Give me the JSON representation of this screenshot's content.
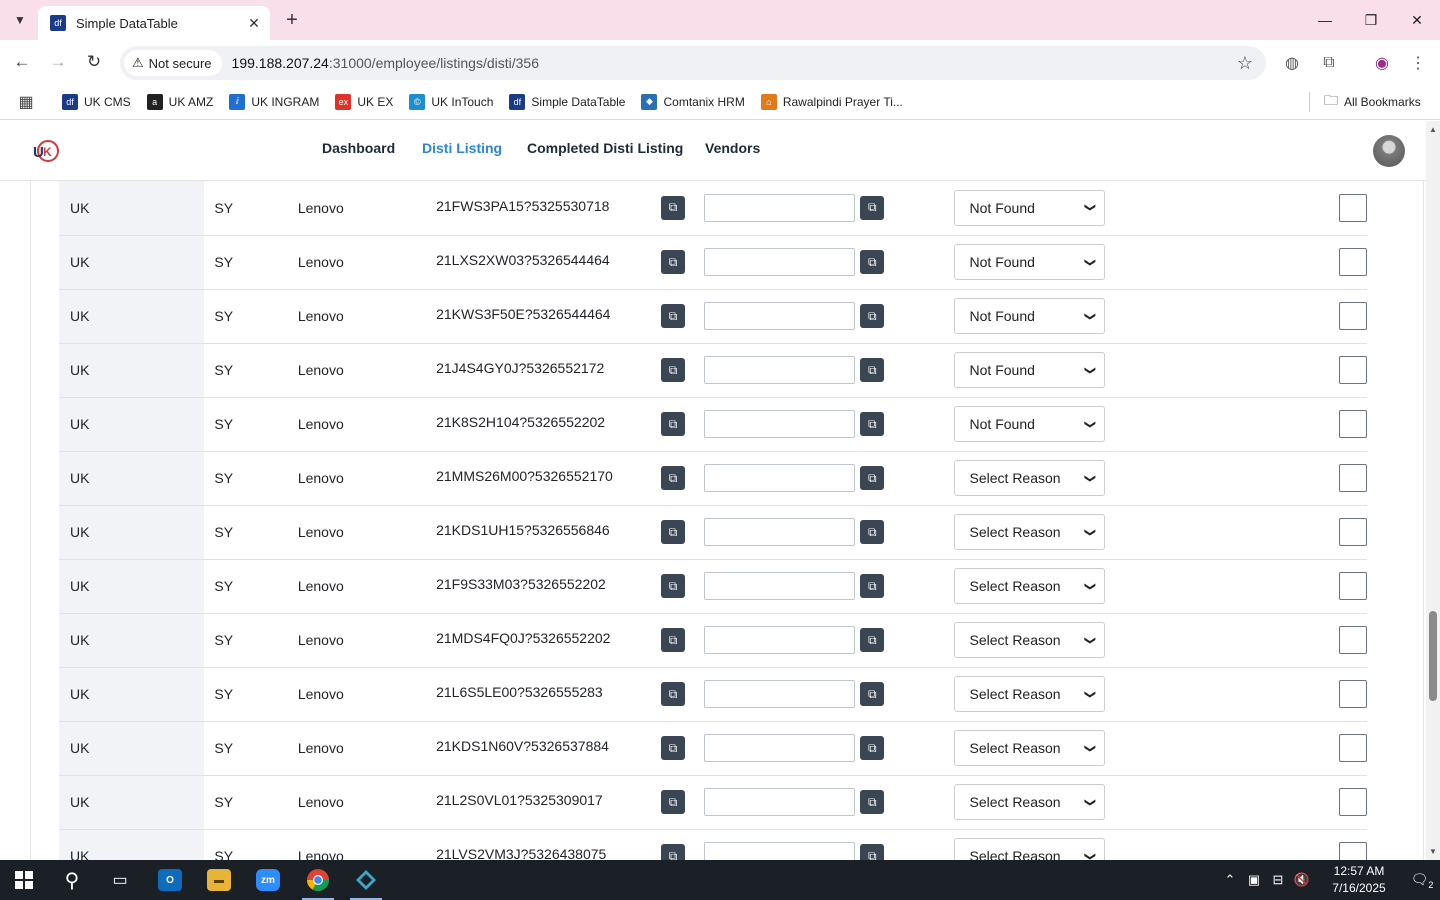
{
  "browser": {
    "tab_title": "Simple DataTable",
    "tab_favicon": "df",
    "security_label": "Not secure",
    "url_host": "199.188.207.24",
    "url_rest": ":31000/employee/listings/disti/356",
    "bookmarks": [
      {
        "label": "UK CMS",
        "icon": "df",
        "color": "#1a3a8a"
      },
      {
        "label": "UK AMZ",
        "icon": "a",
        "color": "#222222"
      },
      {
        "label": "UK INGRAM",
        "icon": "ⅈ",
        "color": "#1f6fd1"
      },
      {
        "label": "UK EX",
        "icon": "ex",
        "color": "#e0312a"
      },
      {
        "label": "UK InTouch",
        "icon": "©",
        "color": "#1a8fd1"
      },
      {
        "label": "Simple DataTable",
        "icon": "df",
        "color": "#1a3a8a"
      },
      {
        "label": "Comtanix HRM",
        "icon": "◆",
        "color": "#2a6fb0"
      },
      {
        "label": "Rawalpindi Prayer Ti...",
        "icon": "⌂",
        "color": "#e07a1a"
      }
    ],
    "all_bookmarks": "All Bookmarks"
  },
  "app": {
    "nav": {
      "dashboard": "Dashboard",
      "disti_listing": "Disti Listing",
      "completed": "Completed Disti Listing",
      "vendors": "Vendors"
    }
  },
  "rows": [
    {
      "country": "UK",
      "code": "SY",
      "brand": "Lenovo",
      "sku": "21FWS3PA15?5325530718",
      "input": "",
      "reason": "Not Found",
      "checked": false
    },
    {
      "country": "UK",
      "code": "SY",
      "brand": "Lenovo",
      "sku": "21LXS2XW03?5326544464",
      "input": "",
      "reason": "Not Found",
      "checked": false
    },
    {
      "country": "UK",
      "code": "SY",
      "brand": "Lenovo",
      "sku": "21KWS3F50E?5326544464",
      "input": "",
      "reason": "Not Found",
      "checked": false
    },
    {
      "country": "UK",
      "code": "SY",
      "brand": "Lenovo",
      "sku": "21J4S4GY0J?5326552172",
      "input": "",
      "reason": "Not Found",
      "checked": false
    },
    {
      "country": "UK",
      "code": "SY",
      "brand": "Lenovo",
      "sku": "21K8S2H104?5326552202",
      "input": "",
      "reason": "Not Found",
      "checked": false
    },
    {
      "country": "UK",
      "code": "SY",
      "brand": "Lenovo",
      "sku": "21MMS26M00?5326552170",
      "input": "",
      "reason": "Select Reason",
      "checked": false
    },
    {
      "country": "UK",
      "code": "SY",
      "brand": "Lenovo",
      "sku": "21KDS1UH15?5326556846",
      "input": "",
      "reason": "Select Reason",
      "checked": false
    },
    {
      "country": "UK",
      "code": "SY",
      "brand": "Lenovo",
      "sku": "21F9S33M03?5326552202",
      "input": "",
      "reason": "Select Reason",
      "checked": false
    },
    {
      "country": "UK",
      "code": "SY",
      "brand": "Lenovo",
      "sku": "21MDS4FQ0J?5326552202",
      "input": "",
      "reason": "Select Reason",
      "checked": false
    },
    {
      "country": "UK",
      "code": "SY",
      "brand": "Lenovo",
      "sku": "21L6S5LE00?5326555283",
      "input": "",
      "reason": "Select Reason",
      "checked": false
    },
    {
      "country": "UK",
      "code": "SY",
      "brand": "Lenovo",
      "sku": "21KDS1N60V?5326537884",
      "input": "",
      "reason": "Select Reason",
      "checked": false
    },
    {
      "country": "UK",
      "code": "SY",
      "brand": "Lenovo",
      "sku": "21L2S0VL01?5325309017",
      "input": "",
      "reason": "Select Reason",
      "checked": false
    },
    {
      "country": "UK",
      "code": "SY",
      "brand": "Lenovo",
      "sku": "21LVS2VM3J?5326438075",
      "input": "",
      "reason": "Select Reason",
      "checked": false
    }
  ],
  "taskbar": {
    "time": "12:57 AM",
    "date": "7/16/2025",
    "notifications": "2"
  }
}
